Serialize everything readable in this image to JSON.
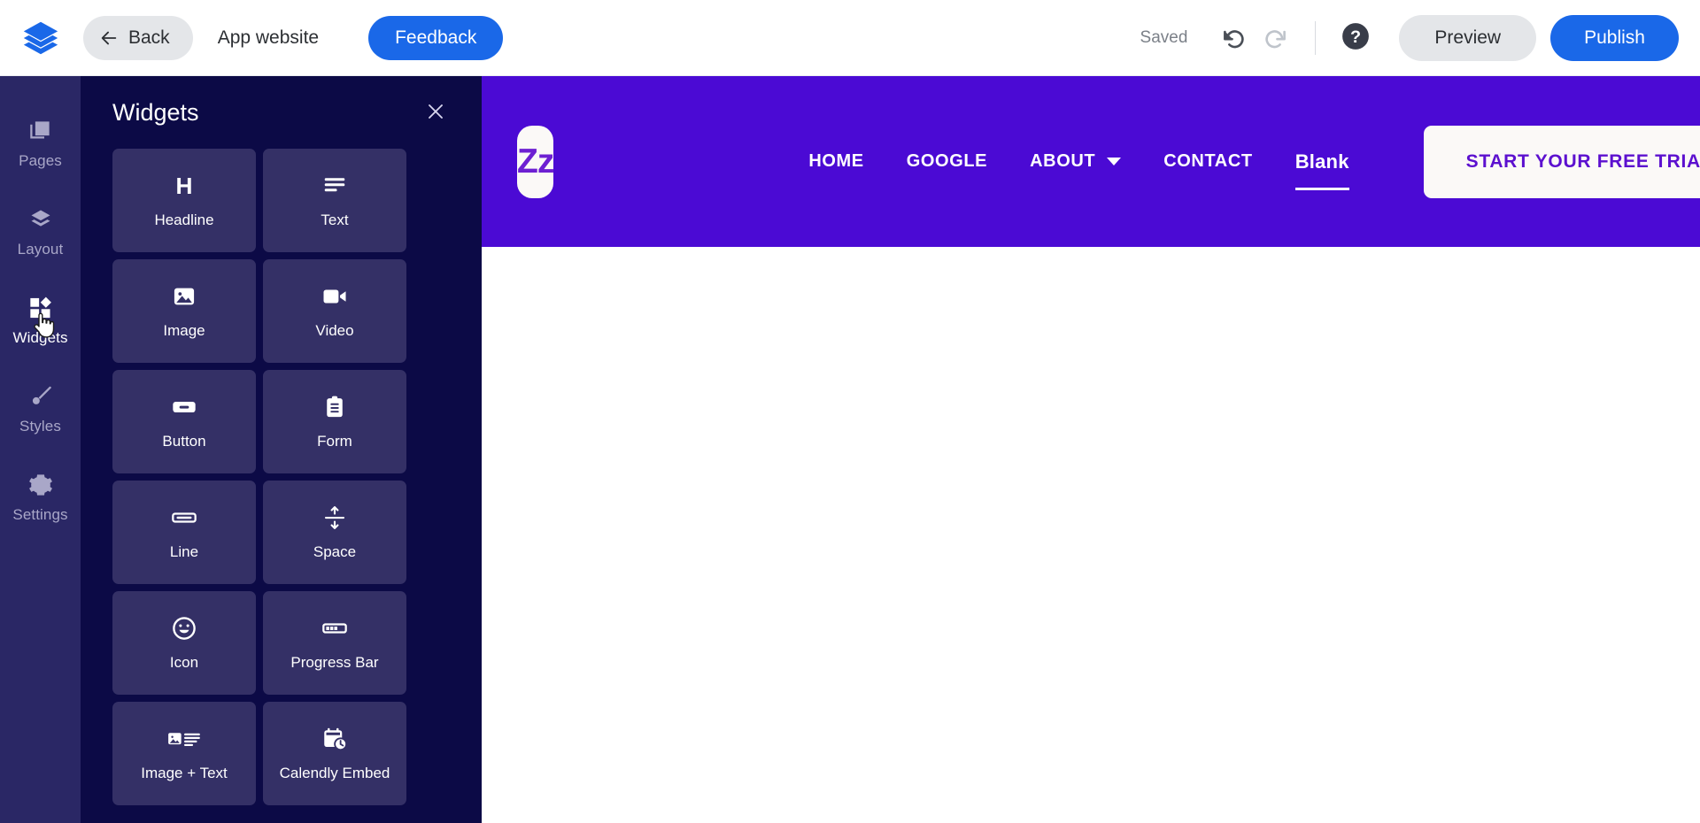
{
  "topbar": {
    "logo_icon": "layers-logo-icon",
    "back_label": "Back",
    "doc_title": "App website",
    "feedback_label": "Feedback",
    "saved_label": "Saved",
    "undo_icon": "undo-icon",
    "redo_icon": "redo-icon",
    "help_icon": "help-circle-icon",
    "preview_label": "Preview",
    "publish_label": "Publish",
    "accent_blue": "#1a68e8",
    "button_grey": "#e4e6e9"
  },
  "rail": {
    "items": [
      {
        "label": "Pages",
        "icon": "pages-icon",
        "active": false
      },
      {
        "label": "Layout",
        "icon": "layout-icon",
        "active": false
      },
      {
        "label": "Widgets",
        "icon": "widgets-icon",
        "active": true
      },
      {
        "label": "Styles",
        "icon": "brush-icon",
        "active": false
      },
      {
        "label": "Settings",
        "icon": "gear-icon",
        "active": false
      }
    ],
    "background": "#2a2765"
  },
  "panel": {
    "title": "Widgets",
    "close_icon": "close-icon",
    "background": "#0c0a46",
    "tile_background": "#343066",
    "tiles": [
      {
        "label": "Headline",
        "icon": "headline-h-icon"
      },
      {
        "label": "Text",
        "icon": "text-lines-icon"
      },
      {
        "label": "Image",
        "icon": "image-icon"
      },
      {
        "label": "Video",
        "icon": "video-camera-icon"
      },
      {
        "label": "Button",
        "icon": "button-icon"
      },
      {
        "label": "Form",
        "icon": "clipboard-form-icon"
      },
      {
        "label": "Line",
        "icon": "horizontal-line-icon"
      },
      {
        "label": "Space",
        "icon": "vertical-space-arrows-icon"
      },
      {
        "label": "Icon",
        "icon": "smiley-face-icon"
      },
      {
        "label": "Progress Bar",
        "icon": "progress-bar-icon"
      },
      {
        "label": "Image + Text",
        "icon": "image-plus-text-icon"
      },
      {
        "label": "Calendly Embed",
        "icon": "calendar-clock-icon"
      }
    ]
  },
  "canvas": {
    "site_header": {
      "background": "#4b0ad4",
      "logo_text": "Zz",
      "logo_color": "#6d20d2",
      "nav": [
        {
          "label": "HOME",
          "has_caret": false,
          "current": false
        },
        {
          "label": "GOOGLE",
          "has_caret": false,
          "current": false
        },
        {
          "label": "ABOUT",
          "has_caret": true,
          "current": false
        },
        {
          "label": "CONTACT",
          "has_caret": false,
          "current": false
        },
        {
          "label": "Blank",
          "has_caret": false,
          "current": true
        }
      ],
      "cta_label": "START YOUR FREE TRIAL",
      "cta_text_color": "#5c10cf"
    }
  },
  "cursor": {
    "icon": "pointing-hand-cursor"
  }
}
